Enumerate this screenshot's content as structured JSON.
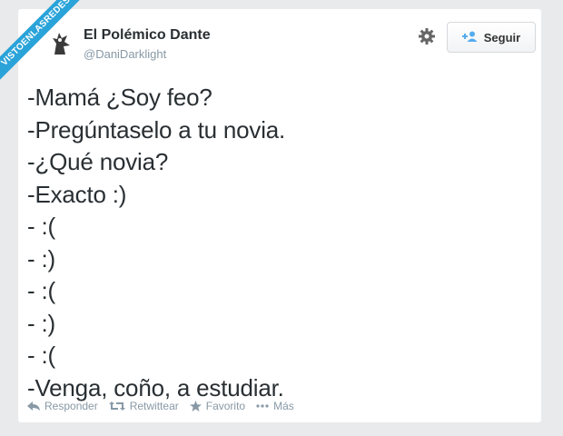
{
  "ribbon": {
    "text": "VISTOENLASREDES"
  },
  "tweet": {
    "author_name": "El Polémico Dante",
    "author_handle": "@DaniDarklight",
    "lines": [
      "-Mamá ¿Soy feo?",
      "-Pregúntaselo a tu novia.",
      "-¿Qué novia?",
      "-Exacto :)",
      "- :(",
      "- :)",
      "- :(",
      "- :)",
      "- :(",
      "-Venga, coño, a estudiar."
    ]
  },
  "follow_button": {
    "label": "Seguir",
    "icon": "add-user-icon"
  },
  "settings": {
    "icon": "gear-icon"
  },
  "actions": {
    "reply": {
      "label": "Responder",
      "icon": "reply-icon"
    },
    "retweet": {
      "label": "Retwittear",
      "icon": "retweet-icon"
    },
    "favorite": {
      "label": "Favorito",
      "icon": "star-icon"
    },
    "more": {
      "label": "Más",
      "icon": "more-icon"
    }
  },
  "colors": {
    "ribbon": "#2aa3d9",
    "text": "#292f33",
    "muted": "#8899a6",
    "background": "#e9eaec"
  }
}
